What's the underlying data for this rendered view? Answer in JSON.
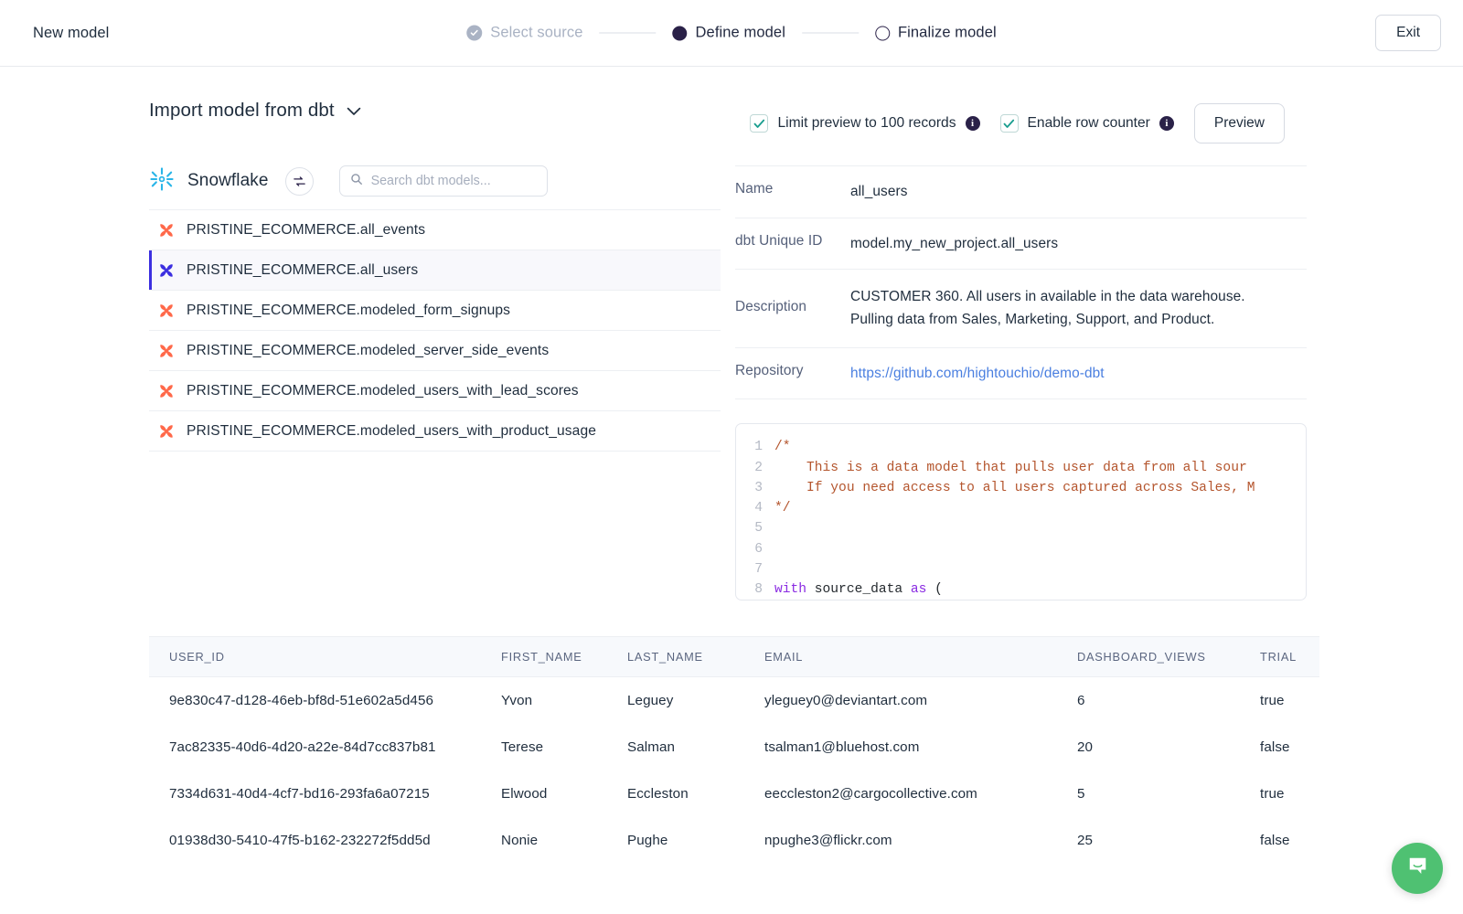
{
  "topbar": {
    "title": "New model",
    "exit_label": "Exit",
    "steps": [
      {
        "label": "Select source",
        "state": "done"
      },
      {
        "label": "Define model",
        "state": "active"
      },
      {
        "label": "Finalize model",
        "state": "todo"
      }
    ]
  },
  "controls": {
    "import_label": "Import model from dbt",
    "limit_preview_label": "Limit preview to 100 records",
    "limit_preview_checked": true,
    "row_counter_label": "Enable row counter",
    "row_counter_checked": true,
    "preview_label": "Preview",
    "info_glyph": "i"
  },
  "source": {
    "name": "Snowflake",
    "search_placeholder": "Search dbt models...",
    "search_value": ""
  },
  "models": [
    {
      "label": "PRISTINE_ECOMMERCE.all_events",
      "selected": false
    },
    {
      "label": "PRISTINE_ECOMMERCE.all_users",
      "selected": true
    },
    {
      "label": "PRISTINE_ECOMMERCE.modeled_form_signups",
      "selected": false
    },
    {
      "label": "PRISTINE_ECOMMERCE.modeled_server_side_events",
      "selected": false
    },
    {
      "label": "PRISTINE_ECOMMERCE.modeled_users_with_lead_scores",
      "selected": false
    },
    {
      "label": "PRISTINE_ECOMMERCE.modeled_users_with_product_usage",
      "selected": false
    }
  ],
  "detail": {
    "name_key": "Name",
    "name_value": "all_users",
    "uid_key": "dbt Unique ID",
    "uid_value": "model.my_new_project.all_users",
    "description_key": "Description",
    "description_line1": "CUSTOMER 360. All users in available in the data warehouse.",
    "description_line2": "Pulling data from Sales, Marketing, Support, and Product.",
    "repository_key": "Repository",
    "repository_value": "https://github.com/hightouchio/demo-dbt"
  },
  "code": {
    "lines": [
      {
        "n": "1",
        "segments": [
          {
            "t": "/*",
            "c": "cmt"
          }
        ]
      },
      {
        "n": "2",
        "segments": [
          {
            "t": "    This is a data model that pulls user data from all sour",
            "c": "cmt"
          }
        ]
      },
      {
        "n": "3",
        "segments": [
          {
            "t": "    If you need access to all users captured across Sales, M",
            "c": "cmt"
          }
        ]
      },
      {
        "n": "4",
        "segments": [
          {
            "t": "*/",
            "c": "cmt"
          }
        ]
      },
      {
        "n": "5",
        "segments": []
      },
      {
        "n": "6",
        "segments": []
      },
      {
        "n": "7",
        "segments": []
      },
      {
        "n": "8",
        "segments": [
          {
            "t": "with",
            "c": "kw"
          },
          {
            "t": " source_data ",
            "c": "code-txt"
          },
          {
            "t": "as",
            "c": "kw"
          },
          {
            "t": " (",
            "c": "code-txt"
          }
        ]
      }
    ]
  },
  "grid": {
    "columns": [
      "USER_ID",
      "FIRST_NAME",
      "LAST_NAME",
      "EMAIL",
      "DASHBOARD_VIEWS",
      "TRIAL"
    ],
    "rows": [
      [
        "9e830c47-d128-46eb-bf8d-51e602a5d456",
        "Yvon",
        "Leguey",
        "yleguey0@deviantart.com",
        "6",
        "true"
      ],
      [
        "7ac82335-40d6-4d20-a22e-84d7cc837b81",
        "Terese",
        "Salman",
        "tsalman1@bluehost.com",
        "20",
        "false"
      ],
      [
        "7334d631-40d4-4cf7-bd16-293fa6a07215",
        "Elwood",
        "Eccleston",
        "eeccleston2@cargocollective.com",
        "5",
        "true"
      ],
      [
        "01938d30-5410-47f5-b162-232272f5dd5d",
        "Nonie",
        "Pughe",
        "npughe3@flickr.com",
        "25",
        "false"
      ]
    ]
  },
  "colors": {
    "accent": "#3c2fe0",
    "dbt_orange": "#ff694a",
    "snowflake_blue": "#29b5e8",
    "chat_green": "#4fc172",
    "link_blue": "#4a7fe0"
  }
}
